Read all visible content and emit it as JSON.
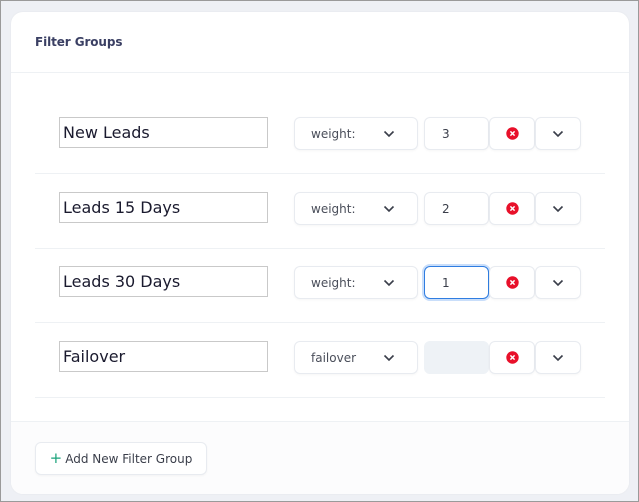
{
  "card": {
    "title": "Filter Groups"
  },
  "rows": [
    {
      "name": "New Leads",
      "select_value": "weight:",
      "weight_value": "3",
      "weight_state": "normal"
    },
    {
      "name": "Leads 15 Days",
      "select_value": "weight:",
      "weight_value": "2",
      "weight_state": "normal"
    },
    {
      "name": "Leads 30 Days",
      "select_value": "weight:",
      "weight_value": "1",
      "weight_state": "focused"
    },
    {
      "name": "Failover",
      "select_value": "failover",
      "weight_value": "",
      "weight_state": "disabled"
    }
  ],
  "icons": {
    "select_chevron": "chevron-down-icon",
    "remove": "x-circle-icon",
    "expand": "chevron-down-icon",
    "add": "plus-icon"
  },
  "footer": {
    "add_button_plus": "+",
    "add_button_label": "Add New Filter Group"
  },
  "colors": {
    "remove_icon": "#e8102a",
    "add_plus": "#1aa37a",
    "focus_border": "#2f7de1",
    "title": "#3a3f63"
  }
}
